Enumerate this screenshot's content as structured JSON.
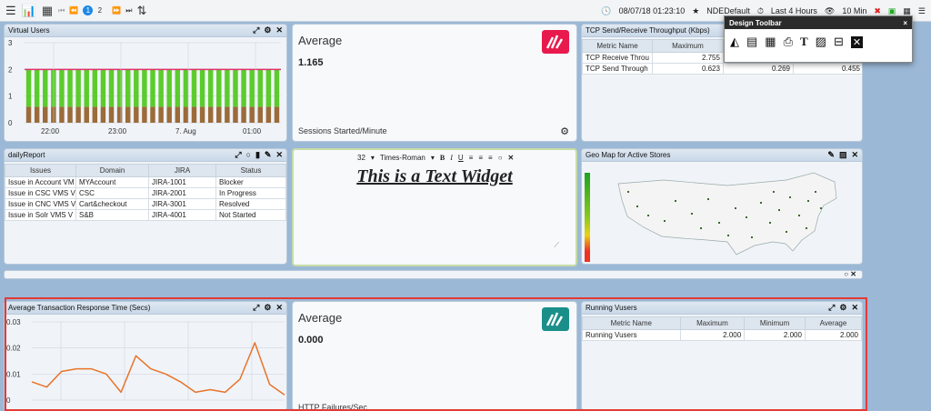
{
  "toolbar": {
    "pages": [
      "1",
      "2"
    ],
    "datetime": "08/07/18 01:23:10",
    "profile": "NDEDefault",
    "time_range": "Last 4 Hours",
    "refresh": "10 Min"
  },
  "design_toolbar": {
    "title": "Design Toolbar",
    "close": "×"
  },
  "panels": {
    "virtual_users": {
      "title": "Virtual Users"
    },
    "avg1": {
      "title": "Average",
      "value": "1.165",
      "subtitle": "Sessions Started/Minute"
    },
    "tcp": {
      "title": "TCP Send/Receive Throughput (Kbps)",
      "headers": [
        "Metric Name",
        "Maximum",
        "",
        ""
      ],
      "rows": [
        [
          "TCP Receive Throu",
          "2.755",
          "",
          ""
        ],
        [
          "TCP Send Through",
          "0.623",
          "0.269",
          "0.455"
        ]
      ]
    },
    "daily_report": {
      "title": "dailyReport",
      "headers": [
        "Issues",
        "Domain",
        "JIRA",
        "Status"
      ],
      "rows": [
        [
          "Issue in Account VM",
          "MYAccount",
          "JIRA-1001",
          "Blocker"
        ],
        [
          "Issue in CSC VMS V",
          "CSC",
          "JIRA-2001",
          "In Progress"
        ],
        [
          "Issue in CNC VMS V",
          "Cart&checkout",
          "JIRA-3001",
          "Resolved"
        ],
        [
          "Issue in Solr VMS V",
          "S&B",
          "JIRA-4001",
          "Not Started"
        ]
      ]
    },
    "text_widget": {
      "font_size": "32",
      "font_name": "Times-Roman",
      "text": "This is a Text Widget"
    },
    "geo_map": {
      "title": "Geo Map for Active Stores"
    },
    "avg_trans": {
      "title": "Average Transaction Response Time (Secs)"
    },
    "avg2": {
      "title": "Average",
      "value": "0.000",
      "subtitle": "HTTP Failures/Sec"
    },
    "running_vusers": {
      "title": "Running Vusers",
      "headers": [
        "Metric Name",
        "Maximum",
        "Minimum",
        "Average"
      ],
      "rows": [
        [
          "Running Vusers",
          "2.000",
          "2.000",
          "2.000"
        ]
      ]
    }
  },
  "colors": {
    "accent": "#1e88e5",
    "logo1": "#e8194d",
    "logo2": "#1a8f8a",
    "highlight": "#e53935"
  },
  "chart_data": [
    {
      "type": "bar",
      "series": [
        {
          "name": "",
          "values": [
            0.6,
            0.6,
            0.6,
            0.6,
            0.6,
            0.6,
            0.6,
            0.6,
            0.6,
            0.6,
            0.6,
            0.6,
            0.6,
            0.6,
            0.6,
            0.6,
            0.6,
            0.6,
            0.6,
            0.6,
            0.6,
            0.6,
            0.6,
            0.6,
            0.6,
            0.6,
            0.6,
            0.6,
            0.6,
            0.6,
            0.6
          ]
        },
        {
          "name": "",
          "values": [
            1.4,
            1.4,
            1.4,
            1.4,
            1.4,
            1.4,
            1.4,
            1.4,
            1.4,
            1.4,
            1.4,
            1.4,
            1.4,
            1.4,
            1.4,
            1.4,
            1.4,
            1.4,
            1.4,
            1.4,
            1.4,
            1.4,
            1.4,
            1.4,
            1.4,
            1.4,
            1.4,
            1.4,
            1.4,
            1.4,
            1.4
          ]
        }
      ],
      "ylim": [
        0,
        3
      ],
      "yticks": [
        "3",
        "2",
        "1",
        "0"
      ],
      "xticks": [
        "22:00",
        "23:00",
        "7. Aug",
        "01:00"
      ],
      "reference_line": 2
    },
    {
      "type": "line",
      "series": [
        {
          "name": "",
          "values": [
            0.007,
            0.005,
            0.011,
            0.012,
            0.012,
            0.01,
            0.003,
            0.017,
            0.012,
            0.01,
            0.007,
            0.003,
            0.004,
            0.003,
            0.008,
            0.022,
            0.006,
            0.002
          ]
        }
      ],
      "ylim": [
        0,
        0.03
      ],
      "yticks": [
        "0.03",
        "0.02",
        "0.01",
        "0"
      ]
    }
  ]
}
